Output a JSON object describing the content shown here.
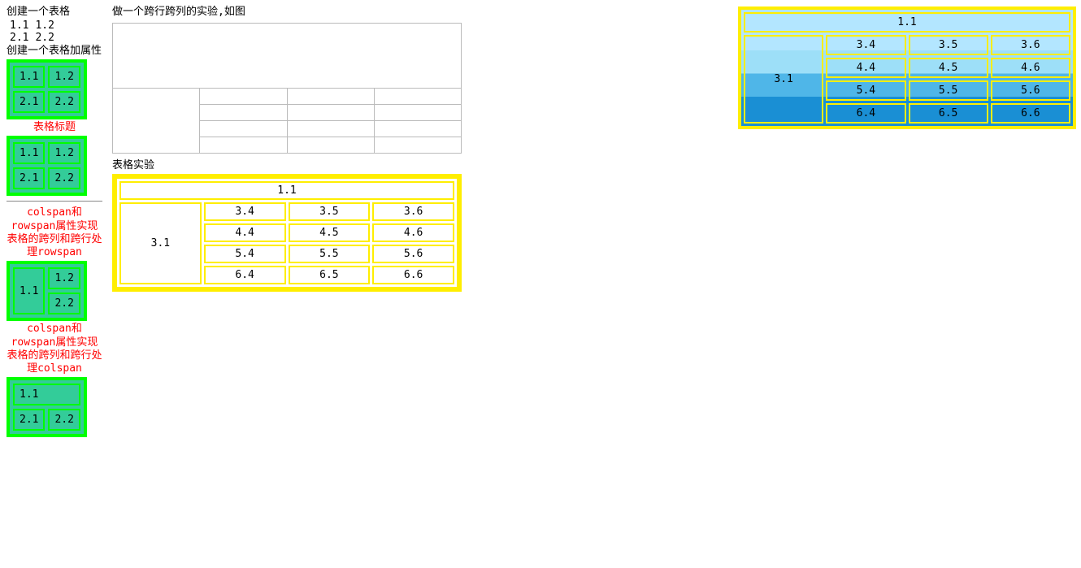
{
  "left": {
    "title1": "创建一个表格",
    "plain": [
      [
        "1.1",
        "1.2"
      ],
      [
        "2.1",
        "2.2"
      ]
    ],
    "title2": "创建一个表格加属性",
    "green1": [
      [
        "1.1",
        "1.2"
      ],
      [
        "2.1",
        "2.2"
      ]
    ],
    "caption1": "表格标题",
    "green2": [
      [
        "1.1",
        "1.2"
      ],
      [
        "2.1",
        "2.2"
      ]
    ],
    "caption2": "colspan和rowspan属性实现表格的跨列和跨行处理rowspan",
    "green3_c11": "1.1",
    "green3_c12": "1.2",
    "green3_c22": "2.2",
    "caption3": "colspan和rowspan属性实现表格的跨列和跨行处理colspan",
    "green4_c11": "1.1",
    "green4_c21": "2.1",
    "green4_c22": "2.2"
  },
  "mid": {
    "heading1": "做一个跨行跨列的实验,如图",
    "heading2": "表格实验",
    "yellow": {
      "r1": "1.1",
      "r2c1": "3.1",
      "rows": [
        [
          "3.4",
          "3.5",
          "3.6"
        ],
        [
          "4.4",
          "4.5",
          "4.6"
        ],
        [
          "5.4",
          "5.5",
          "5.6"
        ],
        [
          "6.4",
          "6.5",
          "6.6"
        ]
      ]
    }
  },
  "right": {
    "sky": {
      "r1": "1.1",
      "r2c1": "3.1",
      "rows": [
        [
          "3.4",
          "3.5",
          "3.6"
        ],
        [
          "4.4",
          "4.5",
          "4.6"
        ],
        [
          "5.4",
          "5.5",
          "5.6"
        ],
        [
          "6.4",
          "6.5",
          "6.6"
        ]
      ]
    }
  }
}
